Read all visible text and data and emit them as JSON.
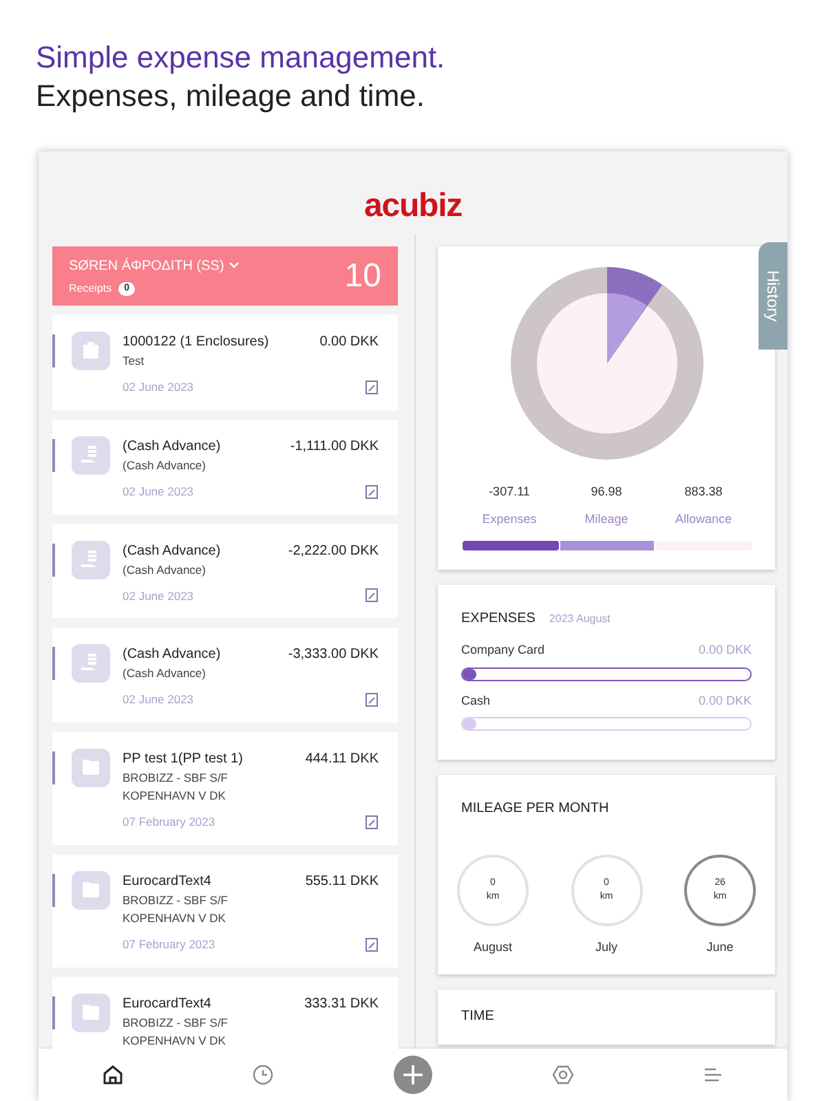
{
  "headline": {
    "line_1": "Simple expense management.",
    "line_2": "Expenses, mileage and time."
  },
  "logo": "acubiz",
  "user_header": {
    "name": "SØREN ÁΦΡΟΔΙΤΗ (SS)",
    "receipts_label": "Receipts",
    "receipts_count": "0",
    "total": "10"
  },
  "entries": [
    {
      "kind": "receipt",
      "title": "1000122 (1 Enclosures)",
      "lines": [
        "Test"
      ],
      "amount": "0.00 DKK",
      "date": "02 June 2023"
    },
    {
      "kind": "cash",
      "title": "(Cash Advance)",
      "lines": [
        "(Cash Advance)"
      ],
      "amount": "-1,111.00 DKK",
      "date": "02 June 2023"
    },
    {
      "kind": "cash",
      "title": "(Cash Advance)",
      "lines": [
        "(Cash Advance)"
      ],
      "amount": "-2,222.00 DKK",
      "date": "02 June 2023"
    },
    {
      "kind": "cash",
      "title": "(Cash Advance)",
      "lines": [
        "(Cash Advance)"
      ],
      "amount": "-3,333.00 DKK",
      "date": "02 June 2023"
    },
    {
      "kind": "card",
      "title": "PP test 1(PP test 1)",
      "lines": [
        "BROBIZZ - SBF S/F",
        "KOPENHAVN V DK"
      ],
      "amount": "444.11 DKK",
      "date": "07 February 2023"
    },
    {
      "kind": "card",
      "title": "EurocardText4",
      "lines": [
        "BROBIZZ - SBF S/F",
        "KOPENHAVN V DK"
      ],
      "amount": "555.11 DKK",
      "date": "07 February 2023"
    },
    {
      "kind": "card",
      "title": "EurocardText4",
      "lines": [
        "BROBIZZ - SBF S/F",
        "KOPENHAVN V DK"
      ],
      "amount": "333.31 DKK"
    }
  ],
  "history_tab": "History",
  "summary": [
    {
      "value": "-307.11",
      "label": "Expenses"
    },
    {
      "value": "96.98",
      "label": "Mileage"
    },
    {
      "value": "883.38",
      "label": "Allowance"
    }
  ],
  "expenses": {
    "title": "EXPENSES",
    "period": "2023 August",
    "rows": [
      {
        "label": "Company Card",
        "amount": "0.00 DKK",
        "level": 0,
        "color": "#7b55b8"
      },
      {
        "label": "Cash",
        "amount": "0.00 DKK",
        "level": 0,
        "color": "#d9ccf0"
      }
    ]
  },
  "mileage": {
    "title": "MILEAGE PER MONTH",
    "months": [
      {
        "value": "0",
        "unit": "km",
        "month": "August",
        "selected": false
      },
      {
        "value": "0",
        "unit": "km",
        "month": "July",
        "selected": false
      },
      {
        "value": "26",
        "unit": "km",
        "month": "June",
        "selected": true
      }
    ]
  },
  "time_card": {
    "title": "TIME"
  },
  "nav": [
    {
      "kind": "home",
      "selected": true
    },
    {
      "kind": "clock",
      "selected": false
    },
    {
      "kind": "add",
      "selected": false
    },
    {
      "kind": "settings",
      "selected": false
    },
    {
      "kind": "menu",
      "selected": false
    }
  ]
}
